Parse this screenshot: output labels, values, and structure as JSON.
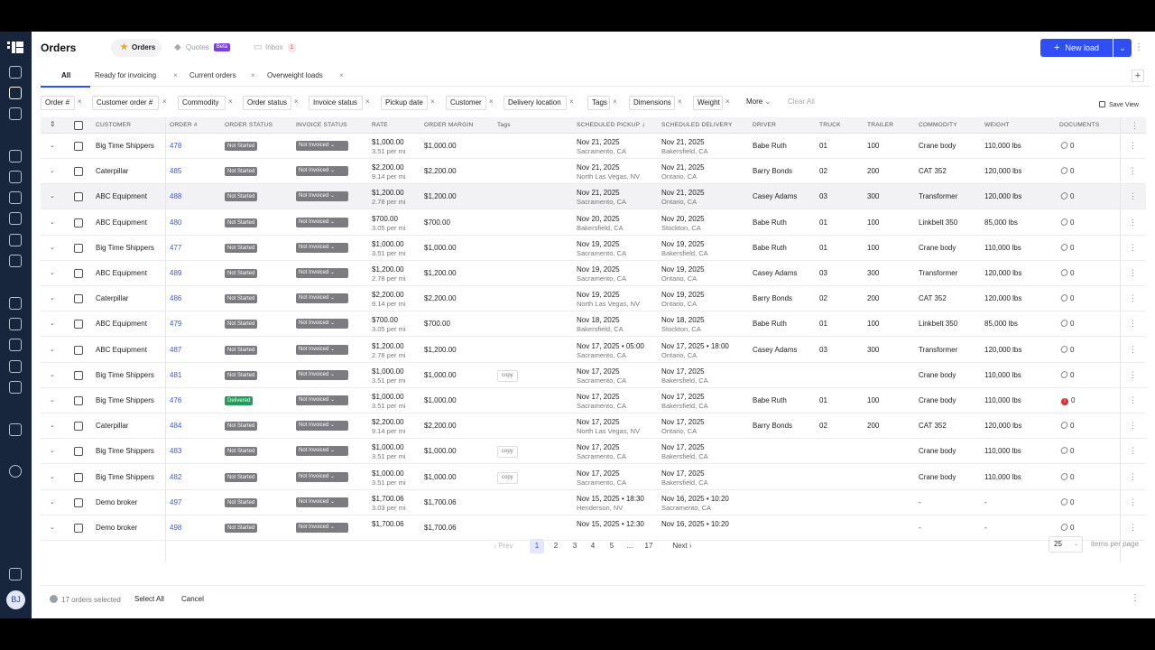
{
  "app": {
    "user_initials": "BJ"
  },
  "header": {
    "title": "Orders",
    "tabs": [
      {
        "label": "Orders",
        "icon": "star-icon"
      },
      {
        "label": "Quotes",
        "badge": "Beta",
        "icon": "tag-icon"
      },
      {
        "label": "Inbox",
        "count": "1",
        "icon": "inbox-icon"
      }
    ],
    "new_load_label": "New load"
  },
  "views": {
    "tabs": [
      "All",
      "Ready for invoicing",
      "Current orders",
      "Overweight loads"
    ]
  },
  "filters": {
    "chips": [
      "Order #",
      "Customer order #",
      "Commodity",
      "Order status",
      "Invoice status",
      "Pickup date",
      "Customer",
      "Delivery location",
      "Tags",
      "Dimensions",
      "Weight"
    ],
    "more_label": "More",
    "clear_label": "Clear All",
    "save_view_label": "Save View"
  },
  "table": {
    "columns": [
      "Customer",
      "Order #",
      "Order Status",
      "Invoice Status",
      "Rate",
      "Order Margin",
      "Tags",
      "Scheduled Pickup",
      "Scheduled Delivery",
      "Driver",
      "Truck",
      "Trailer",
      "Commodity",
      "Weight",
      "Documents"
    ],
    "rows": [
      {
        "customer": "Big Time Shippers",
        "order": "478",
        "status": "Not Started",
        "invoice": "Not Invoiced",
        "rate": "$1,000.00",
        "rate_sub": "3.51 per mi",
        "margin": "$1,000.00",
        "tag": "",
        "pickup": "Nov 21, 2025",
        "pickup_sub": "Sacramento, CA",
        "delivery": "Nov 21, 2025",
        "delivery_sub": "Bakersfield, CA",
        "driver": "Babe Ruth",
        "truck": "01",
        "trailer": "100",
        "commodity": "Crane body",
        "weight": "110,000 lbs",
        "docs": "0",
        "alert": false
      },
      {
        "customer": "Caterpillar",
        "order": "485",
        "status": "Not Started",
        "invoice": "Not Invoiced",
        "rate": "$2,200.00",
        "rate_sub": "9.14 per mi",
        "margin": "$2,200.00",
        "tag": "",
        "pickup": "Nov 21, 2025",
        "pickup_sub": "North Las Vegas, NV",
        "delivery": "Nov 21, 2025",
        "delivery_sub": "Ontario, CA",
        "driver": "Barry Bonds",
        "truck": "02",
        "trailer": "200",
        "commodity": "CAT 352",
        "weight": "120,000 lbs",
        "docs": "0",
        "alert": false
      },
      {
        "customer": "ABC Equipment",
        "order": "488",
        "status": "Not Started",
        "invoice": "Not Invoiced",
        "rate": "$1,200.00",
        "rate_sub": "2.78 per mi",
        "margin": "$1,200.00",
        "tag": "",
        "pickup": "Nov 21, 2025",
        "pickup_sub": "Sacramento, CA",
        "delivery": "Nov 21, 2025",
        "delivery_sub": "Ontario, CA",
        "driver": "Casey Adams",
        "truck": "03",
        "trailer": "300",
        "commodity": "Transformer",
        "weight": "120,000 lbs",
        "docs": "0",
        "alert": false
      },
      {
        "customer": "ABC Equipment",
        "order": "480",
        "status": "Not Started",
        "invoice": "Not Invoiced",
        "rate": "$700.00",
        "rate_sub": "3.05 per mi",
        "margin": "$700.00",
        "tag": "",
        "pickup": "Nov 20, 2025",
        "pickup_sub": "Bakersfield, CA",
        "delivery": "Nov 20, 2025",
        "delivery_sub": "Stockton, CA",
        "driver": "Babe Ruth",
        "truck": "01",
        "trailer": "100",
        "commodity": "Linkbelt 350",
        "weight": "85,000 lbs",
        "docs": "0",
        "alert": false
      },
      {
        "customer": "Big Time Shippers",
        "order": "477",
        "status": "Not Started",
        "invoice": "Not Invoiced",
        "rate": "$1,000.00",
        "rate_sub": "3.51 per mi",
        "margin": "$1,000.00",
        "tag": "",
        "pickup": "Nov 19, 2025",
        "pickup_sub": "Sacramento, CA",
        "delivery": "Nov 19, 2025",
        "delivery_sub": "Bakersfield, CA",
        "driver": "Babe Ruth",
        "truck": "01",
        "trailer": "100",
        "commodity": "Crane body",
        "weight": "110,000 lbs",
        "docs": "0",
        "alert": false
      },
      {
        "customer": "ABC Equipment",
        "order": "489",
        "status": "Not Started",
        "invoice": "Not Invoiced",
        "rate": "$1,200.00",
        "rate_sub": "2.78 per mi",
        "margin": "$1,200.00",
        "tag": "",
        "pickup": "Nov 19, 2025",
        "pickup_sub": "Sacramento, CA",
        "delivery": "Nov 19, 2025",
        "delivery_sub": "Ontario, CA",
        "driver": "Casey Adams",
        "truck": "03",
        "trailer": "300",
        "commodity": "Transformer",
        "weight": "120,000 lbs",
        "docs": "0",
        "alert": false
      },
      {
        "customer": "Caterpillar",
        "order": "486",
        "status": "Not Started",
        "invoice": "Not Invoiced",
        "rate": "$2,200.00",
        "rate_sub": "9.14 per mi",
        "margin": "$2,200.00",
        "tag": "",
        "pickup": "Nov 19, 2025",
        "pickup_sub": "North Las Vegas, NV",
        "delivery": "Nov 19, 2025",
        "delivery_sub": "Ontario, CA",
        "driver": "Barry Bonds",
        "truck": "02",
        "trailer": "200",
        "commodity": "CAT 352",
        "weight": "120,000 lbs",
        "docs": "0",
        "alert": false
      },
      {
        "customer": "ABC Equipment",
        "order": "479",
        "status": "Not Started",
        "invoice": "Not Invoiced",
        "rate": "$700.00",
        "rate_sub": "3.05 per mi",
        "margin": "$700.00",
        "tag": "",
        "pickup": "Nov 18, 2025",
        "pickup_sub": "Bakersfield, CA",
        "delivery": "Nov 18, 2025",
        "delivery_sub": "Stockton, CA",
        "driver": "Babe Ruth",
        "truck": "01",
        "trailer": "100",
        "commodity": "Linkbelt 350",
        "weight": "85,000 lbs",
        "docs": "0",
        "alert": false
      },
      {
        "customer": "ABC Equipment",
        "order": "487",
        "status": "Not Started",
        "invoice": "Not Invoiced",
        "rate": "$1,200.00",
        "rate_sub": "2.78 per mi",
        "margin": "$1,200.00",
        "tag": "",
        "pickup": "Nov 17, 2025 • 05:00",
        "pickup_sub": "Sacramento, CA",
        "delivery": "Nov 17, 2025 • 18:00",
        "delivery_sub": "Ontario, CA",
        "driver": "Casey Adams",
        "truck": "03",
        "trailer": "300",
        "commodity": "Transformer",
        "weight": "120,000 lbs",
        "docs": "0",
        "alert": false
      },
      {
        "customer": "Big Time Shippers",
        "order": "481",
        "status": "Not Started",
        "invoice": "Not Invoiced",
        "rate": "$1,000.00",
        "rate_sub": "3.51 per mi",
        "margin": "$1,000.00",
        "tag": "copy",
        "pickup": "Nov 17, 2025",
        "pickup_sub": "Sacramento, CA",
        "delivery": "Nov 17, 2025",
        "delivery_sub": "Bakersfield, CA",
        "driver": "",
        "truck": "",
        "trailer": "",
        "commodity": "Crane body",
        "weight": "110,000 lbs",
        "docs": "0",
        "alert": false
      },
      {
        "customer": "Big Time Shippers",
        "order": "476",
        "status": "Delivered",
        "invoice": "Not Invoiced",
        "rate": "$1,000.00",
        "rate_sub": "3.51 per mi",
        "margin": "$1,000.00",
        "tag": "",
        "pickup": "Nov 17, 2025",
        "pickup_sub": "Sacramento, CA",
        "delivery": "Nov 17, 2025",
        "delivery_sub": "Bakersfield, CA",
        "driver": "Babe Ruth",
        "truck": "01",
        "trailer": "100",
        "commodity": "Crane body",
        "weight": "110,000 lbs",
        "docs": "0",
        "alert": true
      },
      {
        "customer": "Caterpillar",
        "order": "484",
        "status": "Not Started",
        "invoice": "Not Invoiced",
        "rate": "$2,200.00",
        "rate_sub": "9.14 per mi",
        "margin": "$2,200.00",
        "tag": "",
        "pickup": "Nov 17, 2025",
        "pickup_sub": "North Las Vegas, NV",
        "delivery": "Nov 17, 2025",
        "delivery_sub": "Ontario, CA",
        "driver": "Barry Bonds",
        "truck": "02",
        "trailer": "200",
        "commodity": "CAT 352",
        "weight": "120,000 lbs",
        "docs": "0",
        "alert": false
      },
      {
        "customer": "Big Time Shippers",
        "order": "483",
        "status": "Not Started",
        "invoice": "Not Invoiced",
        "rate": "$1,000.00",
        "rate_sub": "3.51 per mi",
        "margin": "$1,000.00",
        "tag": "copy",
        "pickup": "Nov 17, 2025",
        "pickup_sub": "Sacramento, CA",
        "delivery": "Nov 17, 2025",
        "delivery_sub": "Bakersfield, CA",
        "driver": "",
        "truck": "",
        "trailer": "",
        "commodity": "Crane body",
        "weight": "110,000 lbs",
        "docs": "0",
        "alert": false
      },
      {
        "customer": "Big Time Shippers",
        "order": "482",
        "status": "Not Started",
        "invoice": "Not Invoiced",
        "rate": "$1,000.00",
        "rate_sub": "3.51 per mi",
        "margin": "$1,000.00",
        "tag": "copy",
        "pickup": "Nov 17, 2025",
        "pickup_sub": "Sacramento, CA",
        "delivery": "Nov 17, 2025",
        "delivery_sub": "Bakersfield, CA",
        "driver": "",
        "truck": "",
        "trailer": "",
        "commodity": "Crane body",
        "weight": "110,000 lbs",
        "docs": "0",
        "alert": false
      },
      {
        "customer": "Demo broker",
        "order": "497",
        "status": "Not Started",
        "invoice": "Not Invoiced",
        "rate": "$1,700.06",
        "rate_sub": "3.03 per mi",
        "margin": "$1,700.06",
        "tag": "",
        "pickup": "Nov 15, 2025 • 18:30",
        "pickup_sub": "Henderson, NV",
        "delivery": "Nov 16, 2025 • 10:20",
        "delivery_sub": "Sacramento, CA",
        "driver": "",
        "truck": "",
        "trailer": "",
        "commodity": "-",
        "weight": "-",
        "docs": "0",
        "alert": false
      },
      {
        "customer": "Demo broker",
        "order": "498",
        "status": "Not Started",
        "invoice": "Not Invoiced",
        "rate": "$1,700.06",
        "rate_sub": "",
        "margin": "$1,700.06",
        "tag": "",
        "pickup": "Nov 15, 2025 • 12:30",
        "pickup_sub": "",
        "delivery": "Nov 16, 2025 • 10:20",
        "delivery_sub": "",
        "driver": "",
        "truck": "",
        "trailer": "",
        "commodity": "-",
        "weight": "-",
        "docs": "0",
        "alert": false
      }
    ]
  },
  "pagination": {
    "prev_label": "Prev",
    "next_label": "Next",
    "pages": [
      "1",
      "2",
      "3",
      "4",
      "5",
      "...",
      "17"
    ],
    "current_page": "1",
    "per_page": "25",
    "per_page_label": "items per page"
  },
  "footer": {
    "selected_text": "17 orders selected",
    "select_all_label": "Select All",
    "cancel_label": "Cancel"
  },
  "colors": {
    "accent": "#2f4ff5",
    "rail": "#17253d",
    "delivered": "#1f9d55",
    "badge_gray": "#7c7c80",
    "alert": "#d93030"
  }
}
